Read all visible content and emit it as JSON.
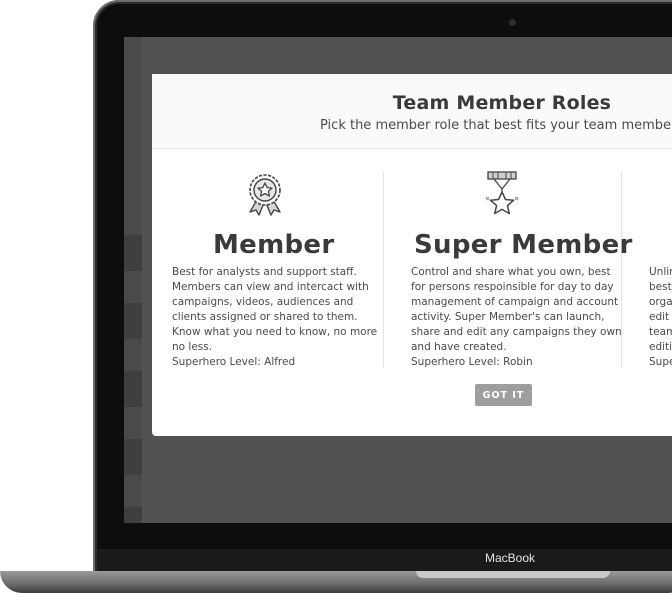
{
  "device": {
    "brand": "MacBook"
  },
  "modal": {
    "title": "Team Member Roles",
    "subtitle": "Pick the member role that best fits your team members",
    "button_label": "GOT IT"
  },
  "roles": [
    {
      "title": "Member",
      "icon": "ribbon-badge-icon",
      "description": [
        "Best for analysts and support staff.",
        "Members can view and intercact with",
        "campaigns, videos, audiences and",
        "clients assigned or shared to them.",
        "Know what you need to know, no more",
        "no less.",
        "Superhero Level: Alfred"
      ]
    },
    {
      "title": "Super Member",
      "icon": "star-medal-icon",
      "description": [
        "Control and share what you own, best",
        "for persons respoinsible for day to day",
        "management of campaign and account",
        "activity. Super Member's can launch,",
        "share and edit any campaigns they own",
        "and have created.",
        "Superhero Level: Robin"
      ]
    },
    {
      "title": "",
      "description": [
        "Unlin",
        "best",
        "orga",
        "edit a",
        "team",
        "editi",
        "Supe"
      ]
    }
  ]
}
